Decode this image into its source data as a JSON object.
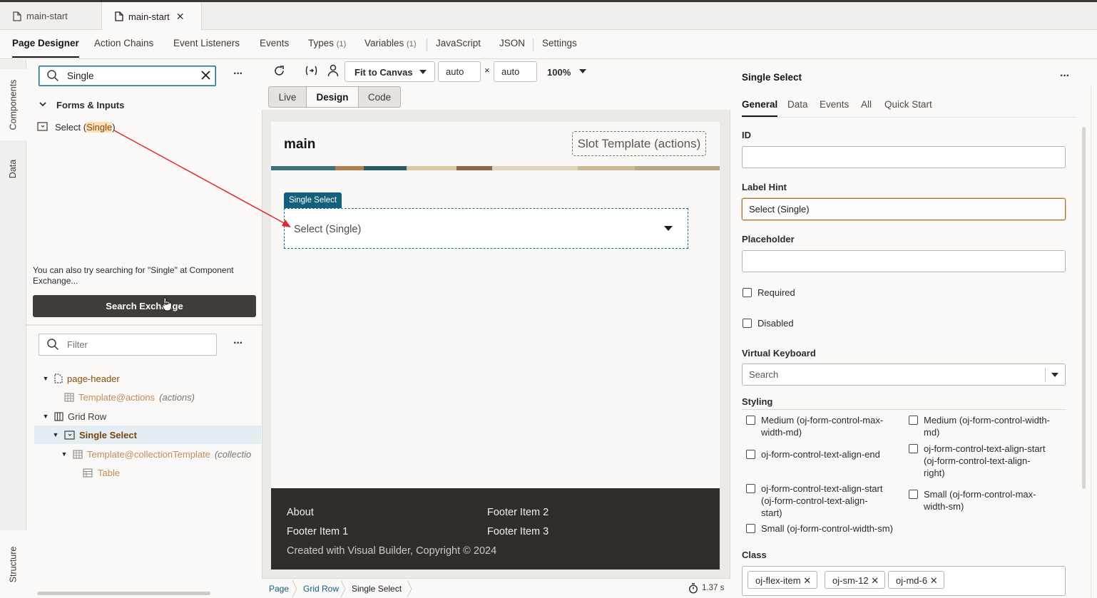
{
  "file_tabs": [
    {
      "label": "main-start"
    },
    {
      "label": "main-start"
    }
  ],
  "nav": {
    "page_designer": "Page Designer",
    "action_chains": "Action Chains",
    "event_listeners": "Event Listeners",
    "events": "Events",
    "types": "Types",
    "types_count": "(1)",
    "variables": "Variables",
    "variables_count": "(1)",
    "javascript": "JavaScript",
    "json": "JSON",
    "settings": "Settings"
  },
  "vtabs": {
    "components": "Components",
    "data": "Data",
    "structure": "Structure"
  },
  "components": {
    "search_value": "Single",
    "group": "Forms & Inputs",
    "item_pre": "Select (",
    "item_hl": "Single",
    "item_post": ")",
    "hint": "You can also try searching for \"Single\" at Component Exchange...",
    "exchange_button": "Search Exchange"
  },
  "structure": {
    "filter_placeholder": "Filter",
    "rows": [
      {
        "name": "page-header",
        "extra": "",
        "note": ""
      },
      {
        "name": "Template",
        "extra": "@actions",
        "note": "(actions)"
      },
      {
        "name": "Grid Row",
        "extra": "",
        "note": ""
      },
      {
        "name": "Single Select",
        "extra": "",
        "note": ""
      },
      {
        "name": "Template",
        "extra": "@collectionTemplate",
        "note": "(collectio"
      },
      {
        "name": "Table",
        "extra": "",
        "note": ""
      }
    ]
  },
  "toolbar": {
    "fit": "Fit to Canvas",
    "width": "auto",
    "times": "×",
    "height": "auto",
    "zoom": "100%",
    "modes": [
      "Live",
      "Design",
      "Code"
    ]
  },
  "canvas": {
    "page_title": "main",
    "slot_label": "Slot Template (actions)",
    "component_tag": "Single Select",
    "select_label": "Select (Single)",
    "footer": {
      "col1": [
        "About",
        "Footer Item 1"
      ],
      "col2": [
        "Footer Item 2",
        "Footer Item 3"
      ],
      "copyright": "Created with Visual Builder, Copyright © 2024"
    }
  },
  "statusbar": {
    "crumbs": [
      "Page",
      "Grid Row",
      "Single Select"
    ],
    "timing": "1.37 s"
  },
  "properties": {
    "title": "Single Select",
    "tabs": [
      "General",
      "Data",
      "Events",
      "All",
      "Quick Start"
    ],
    "id_label": "ID",
    "id_value": "",
    "label_hint_label": "Label Hint",
    "label_hint_value": "Select (Single)",
    "placeholder_label": "Placeholder",
    "placeholder_value": "",
    "required": "Required",
    "disabled": "Disabled",
    "virtual_keyboard_label": "Virtual Keyboard",
    "virtual_keyboard_placeholder": "Search",
    "styling_label": "Styling",
    "styling_left": [
      "Medium (oj-form-control-max-width-md)",
      "oj-form-control-text-align-end",
      "oj-form-control-text-align-start (oj-form-control-text-align-start)",
      "Small (oj-form-control-width-sm)"
    ],
    "styling_right": [
      "Medium (oj-form-control-width-md)",
      "oj-form-control-text-align-start (oj-form-control-text-align-right)",
      "Small (oj-form-control-max-width-sm)"
    ],
    "class_label": "Class",
    "class_chips": [
      "oj-flex-item",
      "oj-sm-12",
      "oj-md-6"
    ]
  },
  "colors": {
    "accent": "#13607c",
    "brand_text": "#8a4b0d",
    "footer_bg": "#312d2a",
    "button_dark": "#403c39"
  }
}
